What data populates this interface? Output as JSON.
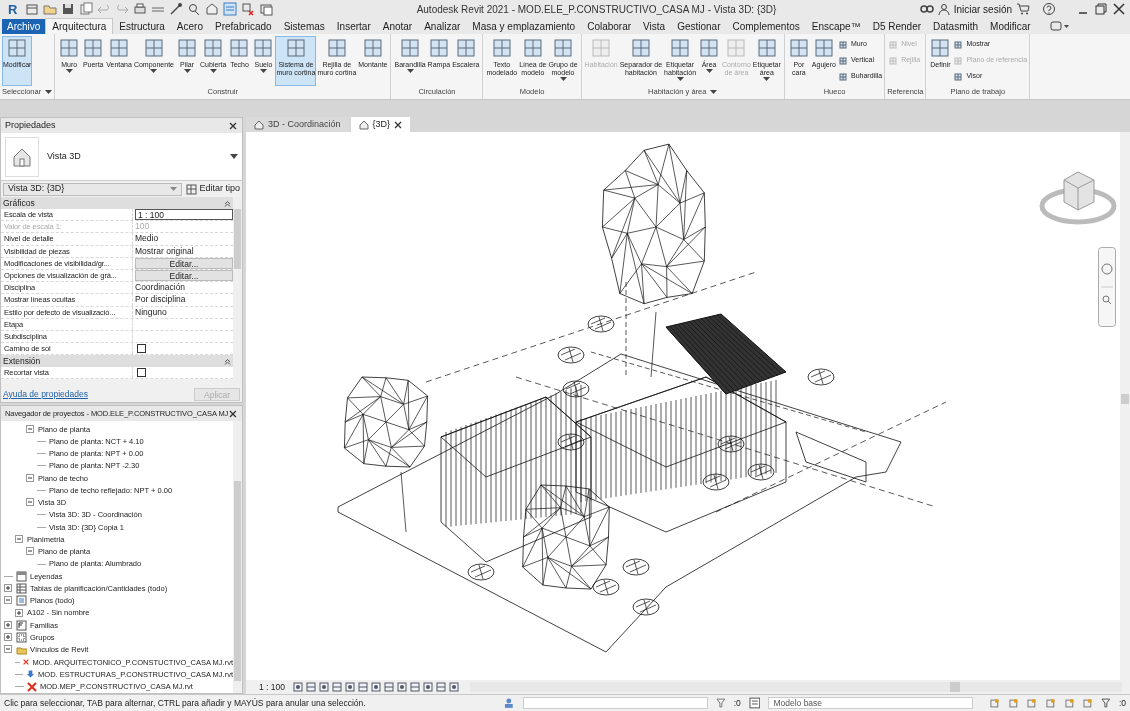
{
  "window": {
    "app_logo": "R",
    "title": "Autodesk Revit 2021 - MOD.ELE_P.CONSTRUCTIVO_CASA MJ - Vista 3D: {3D}",
    "sign_in": "Iniciar sesión"
  },
  "ribbon_tabs": [
    {
      "label": "Archivo",
      "kind": "file",
      "selected": false
    },
    {
      "label": "Arquitectura",
      "kind": "tab",
      "selected": true
    },
    {
      "label": "Estructura",
      "kind": "tab",
      "selected": false
    },
    {
      "label": "Acero",
      "kind": "tab",
      "selected": false
    },
    {
      "label": "Prefabricado",
      "kind": "tab",
      "selected": false
    },
    {
      "label": "Sistemas",
      "kind": "tab",
      "selected": false
    },
    {
      "label": "Insertar",
      "kind": "tab",
      "selected": false
    },
    {
      "label": "Anotar",
      "kind": "tab",
      "selected": false
    },
    {
      "label": "Analizar",
      "kind": "tab",
      "selected": false
    },
    {
      "label": "Masa y emplazamiento",
      "kind": "tab",
      "selected": false
    },
    {
      "label": "Colaborar",
      "kind": "tab",
      "selected": false
    },
    {
      "label": "Vista",
      "kind": "tab",
      "selected": false
    },
    {
      "label": "Gestionar",
      "kind": "tab",
      "selected": false
    },
    {
      "label": "Complementos",
      "kind": "tab",
      "selected": false
    },
    {
      "label": "Enscape™",
      "kind": "tab",
      "selected": false
    },
    {
      "label": "D5 Render",
      "kind": "tab",
      "selected": false
    },
    {
      "label": "Datasmith",
      "kind": "tab",
      "selected": false
    },
    {
      "label": "Modificar",
      "kind": "tab",
      "selected": false
    }
  ],
  "ribbon_panels": [
    {
      "title": "Seleccionar",
      "menu": true,
      "tools": [
        {
          "label": "Modificar",
          "kind": "large",
          "selected": true,
          "disabled": false,
          "dropdown": false
        }
      ]
    },
    {
      "title": "Construir",
      "menu": false,
      "tools": [
        {
          "label": "Muro",
          "kind": "large",
          "selected": false,
          "disabled": false,
          "dropdown": true
        },
        {
          "label": "Puerta",
          "kind": "large",
          "selected": false,
          "disabled": false,
          "dropdown": false
        },
        {
          "label": "Ventana",
          "kind": "large",
          "selected": false,
          "disabled": false,
          "dropdown": false
        },
        {
          "label": "Componente",
          "kind": "large",
          "selected": false,
          "disabled": false,
          "dropdown": true
        },
        {
          "label": "Pilar",
          "kind": "large",
          "selected": false,
          "disabled": false,
          "dropdown": true
        },
        {
          "label": "Cubierta",
          "kind": "large",
          "selected": false,
          "disabled": false,
          "dropdown": true
        },
        {
          "label": "Techo",
          "kind": "large",
          "selected": false,
          "disabled": false,
          "dropdown": false
        },
        {
          "label": "Suelo",
          "kind": "large",
          "selected": false,
          "disabled": false,
          "dropdown": true
        },
        {
          "label": "Sistema de muro cortina",
          "kind": "large",
          "selected": true,
          "disabled": false,
          "dropdown": false
        },
        {
          "label": "Rejilla de muro cortina",
          "kind": "large",
          "selected": false,
          "disabled": false,
          "dropdown": false
        },
        {
          "label": "Montante",
          "kind": "large",
          "selected": false,
          "disabled": false,
          "dropdown": false
        }
      ]
    },
    {
      "title": "Circulación",
      "menu": false,
      "tools": [
        {
          "label": "Barandilla",
          "kind": "large",
          "selected": false,
          "disabled": false,
          "dropdown": true
        },
        {
          "label": "Rampa",
          "kind": "large",
          "selected": false,
          "disabled": false,
          "dropdown": false
        },
        {
          "label": "Escalera",
          "kind": "large",
          "selected": false,
          "disabled": false,
          "dropdown": false
        }
      ]
    },
    {
      "title": "Modelo",
      "menu": false,
      "tools": [
        {
          "label": "Texto modelado",
          "kind": "large",
          "selected": false,
          "disabled": false,
          "dropdown": false
        },
        {
          "label": "Línea de modelo",
          "kind": "large",
          "selected": false,
          "disabled": false,
          "dropdown": false
        },
        {
          "label": "Grupo de modelo",
          "kind": "large",
          "selected": false,
          "disabled": false,
          "dropdown": true
        }
      ]
    },
    {
      "title": "Habitación y área",
      "menu": true,
      "tools": [
        {
          "label": "Habitación",
          "kind": "large",
          "selected": false,
          "disabled": true,
          "dropdown": false
        },
        {
          "label": "Separador de habitación",
          "kind": "large",
          "selected": false,
          "disabled": false,
          "dropdown": false
        },
        {
          "label": "Etiquetar habitación",
          "kind": "large",
          "selected": false,
          "disabled": false,
          "dropdown": true
        },
        {
          "label": "Área",
          "kind": "large",
          "selected": false,
          "disabled": false,
          "dropdown": true
        },
        {
          "label": "Contorno de área",
          "kind": "large",
          "selected": false,
          "disabled": true,
          "dropdown": false
        },
        {
          "label": "Etiquetar área",
          "kind": "large",
          "selected": false,
          "disabled": false,
          "dropdown": true
        }
      ]
    },
    {
      "title": "Hueco",
      "menu": false,
      "tools": [
        {
          "label": "Por cara",
          "kind": "large",
          "selected": false,
          "disabled": false,
          "dropdown": false
        },
        {
          "label": "Agujero",
          "kind": "large",
          "selected": false,
          "disabled": false,
          "dropdown": false
        },
        {
          "label": "Muro",
          "kind": "small",
          "selected": false,
          "disabled": false,
          "dropdown": false
        },
        {
          "label": "Vertical",
          "kind": "small",
          "selected": false,
          "disabled": false,
          "dropdown": false
        },
        {
          "label": "Buhardilla",
          "kind": "small",
          "selected": false,
          "disabled": false,
          "dropdown": false
        }
      ]
    },
    {
      "title": "Referencia",
      "menu": false,
      "tools": [
        {
          "label": "Nivel",
          "kind": "small",
          "selected": false,
          "disabled": true,
          "dropdown": false
        },
        {
          "label": "Rejilla",
          "kind": "small",
          "selected": false,
          "disabled": true,
          "dropdown": false
        }
      ]
    },
    {
      "title": "Plano de trabajo",
      "menu": false,
      "tools": [
        {
          "label": "Definir",
          "kind": "large",
          "selected": false,
          "disabled": false,
          "dropdown": false
        },
        {
          "label": "Mostrar",
          "kind": "small",
          "selected": false,
          "disabled": false,
          "dropdown": false
        },
        {
          "label": "Plano de referencia",
          "kind": "small",
          "selected": false,
          "disabled": true,
          "dropdown": false
        },
        {
          "label": "Visor",
          "kind": "small",
          "selected": false,
          "disabled": false,
          "dropdown": false
        }
      ]
    }
  ],
  "properties": {
    "title": "Propiedades",
    "type_name": "Vista 3D",
    "type_selector": "Vista 3D: {3D}",
    "edit_type": "Editar tipo",
    "sections": [
      {
        "title": "Gráficos",
        "rows": [
          {
            "label": "Escala de vista",
            "value": "1 : 100",
            "kind": "input",
            "disabled": false
          },
          {
            "label": "Valor de escala    1:",
            "value": "100",
            "kind": "text",
            "disabled": true
          },
          {
            "label": "Nivel de detalle",
            "value": "Medio",
            "kind": "text",
            "disabled": false
          },
          {
            "label": "Visibilidad de piezas",
            "value": "Mostrar original",
            "kind": "text",
            "disabled": false
          },
          {
            "label": "Modificaciones de visibilidad/gr...",
            "value": "Editar...",
            "kind": "button",
            "disabled": false
          },
          {
            "label": "Opciones de visualización de grá...",
            "value": "Editar...",
            "kind": "button",
            "disabled": false
          },
          {
            "label": "Disciplina",
            "value": "Coordinación",
            "kind": "text",
            "disabled": false
          },
          {
            "label": "Mostrar líneas ocultas",
            "value": "Por disciplina",
            "kind": "text",
            "disabled": false
          },
          {
            "label": "Estilo por defecto de visualizació...",
            "value": "Ninguno",
            "kind": "text",
            "disabled": false
          },
          {
            "label": "Etapa",
            "kind": "text",
            "disabled": false
          },
          {
            "label": "Subdisciplina",
            "kind": "text",
            "disabled": false
          },
          {
            "label": "Camino de sol",
            "kind": "checkbox",
            "checked": false,
            "disabled": false
          }
        ]
      },
      {
        "title": "Extensión",
        "rows": [
          {
            "label": "Recortar vista",
            "kind": "checkbox",
            "checked": false,
            "disabled": false
          }
        ]
      }
    ],
    "help_link": "Ayuda de propiedades",
    "apply": {
      "label": "Aplicar",
      "disabled": true
    }
  },
  "project_browser": {
    "title": "Navegador de proyectos - MOD.ELE_P.CONSTRUCTIVO_CASA MJ",
    "tree": [
      {
        "children": [
          {
            "children": [
              {
                "label": "Plano de planta",
                "expanded": true,
                "children": [
                  {
                    "label": "Plano de planta: NCT + 4.10"
                  },
                  {
                    "label": "Plano de planta: NPT + 0.00"
                  },
                  {
                    "label": "Plano de planta: NPT -2.30"
                  }
                ]
              },
              {
                "label": "Plano de techo",
                "expanded": true,
                "children": [
                  {
                    "label": "Plano de techo reflejado: NPT + 0.00"
                  }
                ]
              },
              {
                "label": "Vista 3D",
                "expanded": true,
                "children": [
                  {
                    "label": "Vista 3D: 3D - Coordinación"
                  },
                  {
                    "label": "Vista 3D: {3D} Copia 1"
                  }
                ]
              }
            ]
          },
          {
            "label": "Planimetria",
            "expanded": true,
            "children": [
              {
                "label": "Plano de planta",
                "expanded": true,
                "children": [
                  {
                    "label": "Plano de planta: Alumbrado"
                  }
                ]
              }
            ]
          }
        ]
      },
      {
        "label": "Leyendas",
        "kind": "legend"
      },
      {
        "label": "Tablas de planificación/Cantidades (todo)",
        "kind": "schedule",
        "expanded": false
      },
      {
        "label": "Planos (todo)",
        "kind": "sheet",
        "expanded": true,
        "children": [
          {
            "label": "A102 - Sin nombre",
            "expanded": false
          }
        ]
      },
      {
        "label": "Familias",
        "kind": "family",
        "expanded": false
      },
      {
        "label": "Grupos",
        "kind": "group",
        "expanded": false
      },
      {
        "label": "Vínculos de Revit",
        "kind": "link",
        "expanded": true,
        "children": [
          {
            "label": "MOD. ARQUITECTONICO_P.CONSTUCTIVO_CASA MJ.rvt",
            "loaded": false
          },
          {
            "label": "MOD. ESTRUCTURAS_P.CONSTRUCTIVO_CASA MJ.rvt",
            "loaded": true
          },
          {
            "label": "MOD.MEP_P.CONSTRUCTIVO_CASA MJ.rvt",
            "loaded": false
          }
        ]
      }
    ]
  },
  "view_tabs": [
    {
      "label": "3D - Coordinación",
      "selected": false
    },
    {
      "label": "{3D}",
      "selected": true
    }
  ],
  "view_bar": {
    "scale": "1 : 100"
  },
  "status_bar": {
    "message": "Clic para seleccionar, TAB para alternar, CTRL para añadir y MAYÚS para anular una selección.",
    "workset_count": ":0",
    "design_option": "Modelo base",
    "filter_count": ":0"
  }
}
